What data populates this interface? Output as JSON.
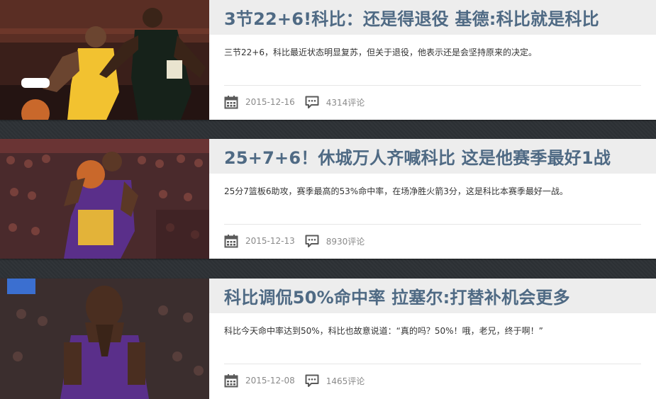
{
  "articles": [
    {
      "title": "3节22+6!科比：还是得退役 基德:科比就是科比",
      "summary": "三节22+6，科比最近状态明显复苏，但关于退役，他表示还是会坚持原来的决定。",
      "date": "2015-12-16",
      "comments": "4314评论",
      "image_icon": "player-photo-icon"
    },
    {
      "title": "25+7+6！休城万人齐喊科比 这是他赛季最好1战",
      "summary": "25分7篮板6助攻，赛季最高的53%命中率，在场净胜火箭3分，这是科比本赛季最好一战。",
      "date": "2015-12-13",
      "comments": "8930评论",
      "image_icon": "player-photo-icon"
    },
    {
      "title": "科比调侃50%命中率 拉塞尔:打替补机会更多",
      "summary": "科比今天命中率达到50%，科比也故意说道：“真的吗？50%！哦，老兄，终于啊！”",
      "date": "2015-12-08",
      "comments": "1465评论",
      "image_icon": "player-photo-icon"
    }
  ],
  "icons": {
    "date": "calendar-icon",
    "comments": "comment-bubble-icon"
  },
  "colors": {
    "title": "#4f6a84",
    "title_bg": "#ededed",
    "meta_text": "#8a8a8a",
    "background": "#2c3034"
  }
}
